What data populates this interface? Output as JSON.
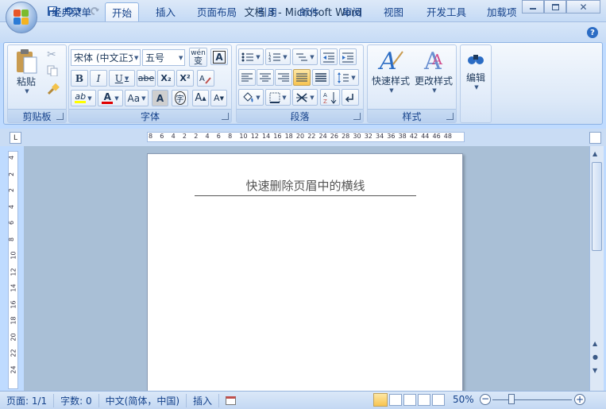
{
  "window": {
    "title": "文档 3 - Microsoft Word",
    "minimize_icon": "minimize-icon",
    "restore_icon": "restore-icon",
    "close_icon": "close-icon"
  },
  "qat": {
    "save_icon": "save-icon",
    "undo_icon": "undo-icon",
    "redo_icon": "redo-icon",
    "print_icon": "print-icon",
    "customize_icon": "chevron-down-icon"
  },
  "tabs": [
    "经典菜单",
    "开始",
    "插入",
    "页面布局",
    "引用",
    "邮件",
    "审阅",
    "视图",
    "开发工具",
    "加载项"
  ],
  "active_tab": "开始",
  "ribbon": {
    "clipboard": {
      "paste_label": "粘贴",
      "group_label": "剪贴板"
    },
    "font": {
      "font_name": "宋体 (中文正文",
      "font_size": "五号",
      "group_label": "字体",
      "bold": "B",
      "italic": "I",
      "underline": "U",
      "strike": "abe",
      "subscript": "X₂",
      "superscript": "X²",
      "change_case": "Aa",
      "grow": "A",
      "shrink": "A",
      "char_border": "A",
      "enclose": "字",
      "phonetic": "wén",
      "font_color": "A",
      "highlight": "ab"
    },
    "paragraph": {
      "group_label": "段落"
    },
    "styles": {
      "quick_styles": "快速样式",
      "change_styles": "更改样式",
      "group_label": "样式"
    },
    "editing": {
      "label": "编辑"
    }
  },
  "ruler": {
    "ticks": [
      "8",
      "6",
      "4",
      "2",
      "2",
      "4",
      "6",
      "8",
      "10",
      "12",
      "14",
      "16",
      "18",
      "20",
      "22",
      "24",
      "26",
      "28",
      "30",
      "32",
      "34",
      "36",
      "38",
      "42",
      "44",
      "46",
      "48"
    ],
    "vticks": [
      "4",
      "2",
      "2",
      "4",
      "6",
      "8",
      "10",
      "12",
      "14",
      "16",
      "18",
      "20",
      "22",
      "24"
    ],
    "corner": "L"
  },
  "document": {
    "header_text": "快速删除页眉中的横线"
  },
  "status": {
    "page": "页面: 1/1",
    "words": "字数: 0",
    "language": "中文(简体，中国)",
    "mode": "插入",
    "zoom": "50%"
  },
  "colors": {
    "accent": "#15428b",
    "ribbon_bg": "#dde9f8",
    "highlight": "#f8c450"
  }
}
